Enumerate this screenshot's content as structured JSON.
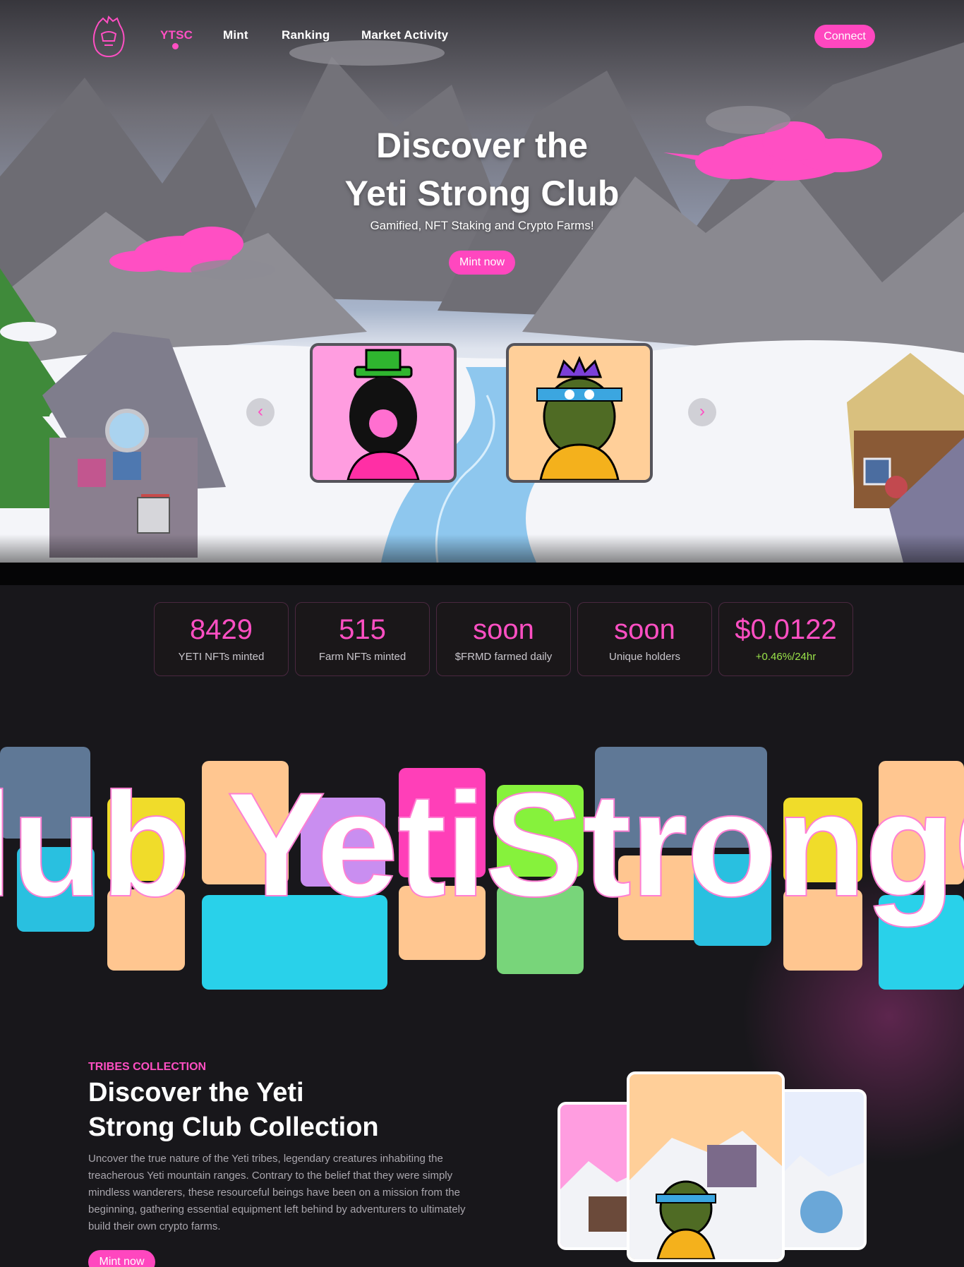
{
  "nav": {
    "logo_icon": "yeti-head-icon",
    "links": [
      "YTSC",
      "Mint",
      "Ranking",
      "Market Activity"
    ],
    "connect_label": "Connect"
  },
  "hero": {
    "title_line1": "Discover the",
    "title_line2": "Yeti Strong Club",
    "subtitle": "Gamified, NFT Staking and Crypto Farms!",
    "cta_label": "Mint now",
    "prev_icon": "chevron-left-icon",
    "next_icon": "chevron-right-icon"
  },
  "stats": [
    {
      "value": "8429",
      "label": "YETI NFTs minted"
    },
    {
      "value": "515",
      "label": "Farm NFTs minted"
    },
    {
      "value": "soon",
      "label": "$FRMD farmed daily"
    },
    {
      "value": "soon",
      "label": "Unique holders"
    },
    {
      "value": "$0.0122",
      "label": "+0.46%/24hr"
    }
  ],
  "marquee": {
    "text": "lub YetiStrongC"
  },
  "collection": {
    "eyebrow": "TRIBES COLLECTION",
    "title_line1": "Discover the Yeti",
    "title_line2": "Strong Club Collection",
    "description": "Uncover the true nature of the Yeti tribes, legendary creatures inhabiting the treacherous Yeti mountain ranges. Contrary to the belief that they were simply mindless wanderers, these resourceful beings have been on a mission from the beginning, gathering essential equipment left behind by adventurers to ultimately build their own crypto farms.",
    "cta_label": "Mint now"
  },
  "colors": {
    "accent": "#ff4fc3",
    "background": "#18171b",
    "positive": "#9be44a"
  }
}
